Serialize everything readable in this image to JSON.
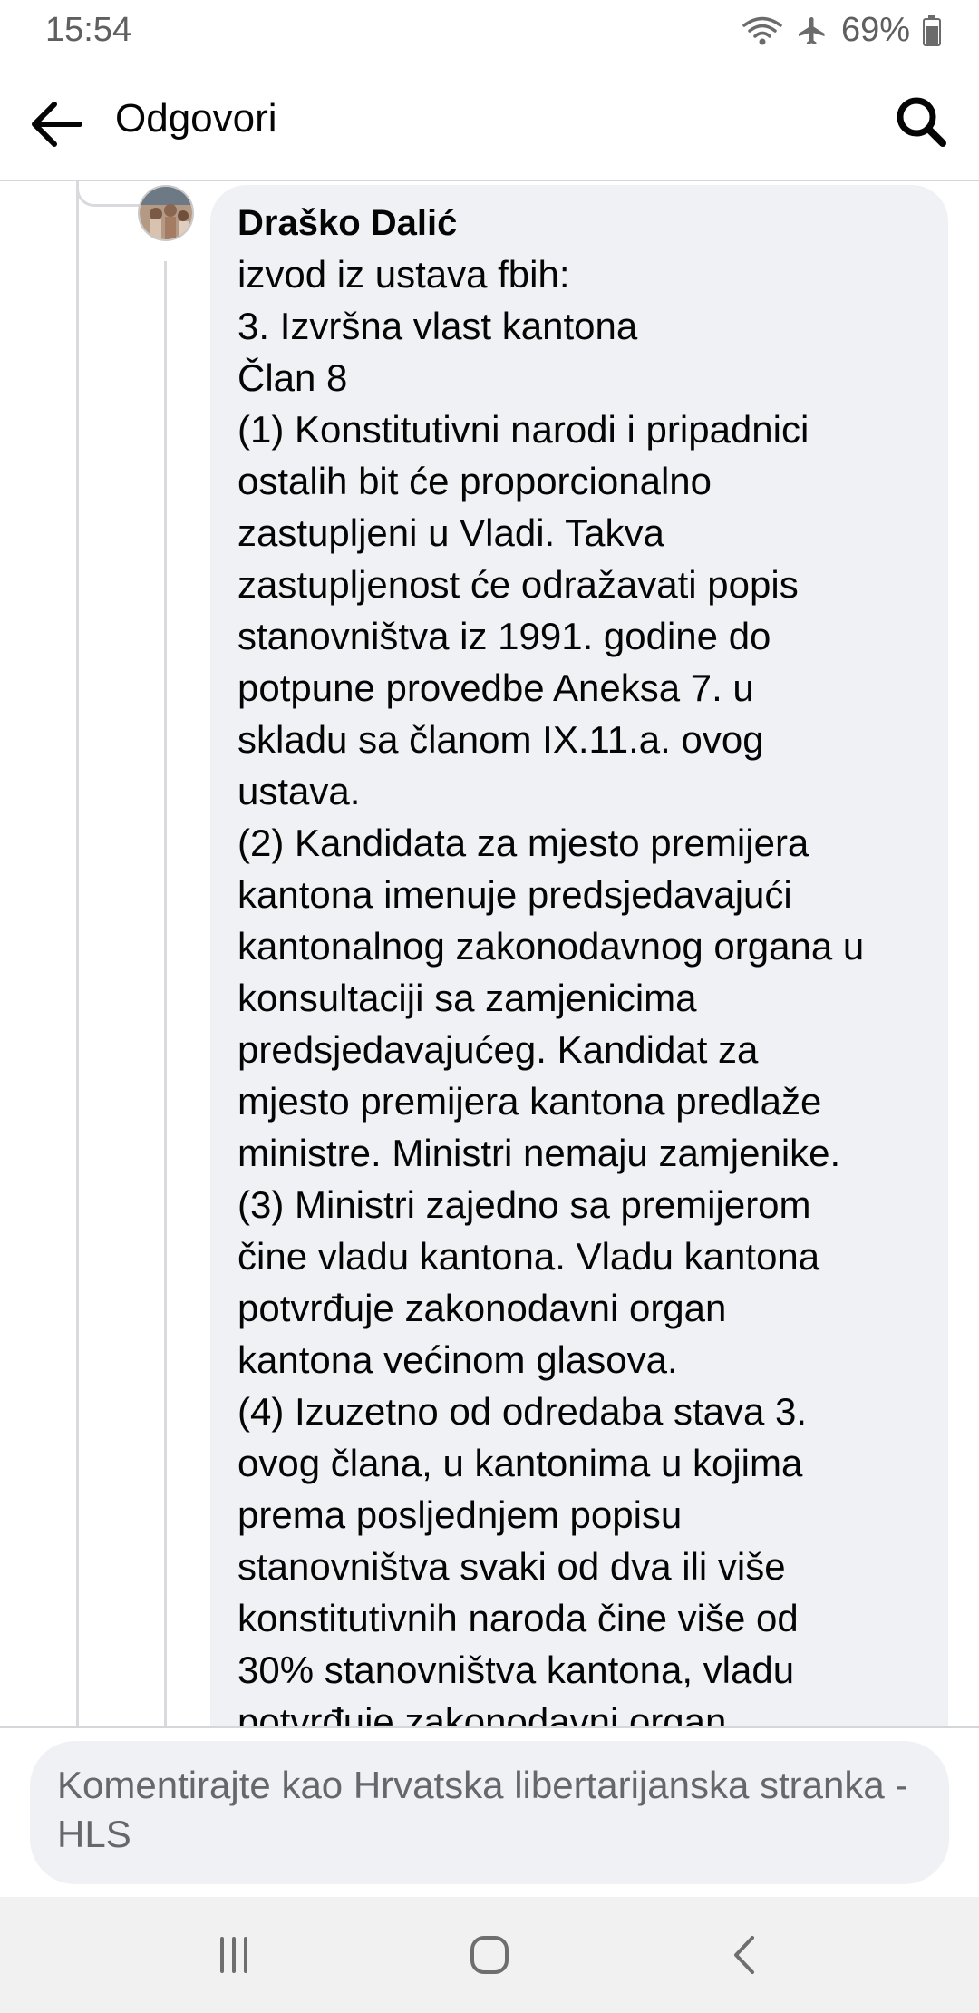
{
  "status": {
    "time": "15:54",
    "battery": "69%",
    "icons": [
      "wifi-icon",
      "airplane-icon",
      "battery-icon"
    ]
  },
  "app_bar": {
    "title": "Odgovori",
    "icons": [
      "back-arrow-icon",
      "search-icon"
    ]
  },
  "comment": {
    "author": "Draško Dalić",
    "lines": [
      "izvod iz ustava fbih:",
      "3. Izvršna vlast kantona",
      "Član 8",
      "(1) Konstitutivni narodi i pripadnici",
      "ostalih bit će proporcionalno",
      "zastupljeni u Vladi. Takva",
      "zastupljenost će odražavati popis",
      "stanovništva iz 1991. godine do",
      "potpune provedbe Aneksa 7. u",
      "skladu sa članom IX.11.a. ovog",
      "ustava.",
      "(2) Kandidata za mjesto premijera",
      "kantona imenuje predsjedavajući",
      "kantonalnog zakonodavnog organa u",
      "konsultaciji sa zamjenicima",
      "predsjedavajućeg. Kandidat za",
      "mjesto premijera kantona predlaže",
      "ministre. Ministri nemaju zamjenike.",
      "(3) Ministri zajedno sa premijerom",
      "čine vladu kantona. Vladu kantona",
      "potvrđuje zakonodavni organ",
      "kantona većinom glasova.",
      "(4) Izuzetno od odredaba stava 3.",
      "ovog člana, u kantonima u kojima",
      "prema posljednjem popisu",
      "stanovništva svaki od dva ili više",
      "konstitutivnih naroda čine više od",
      "30% stanovništva kantona, vladu",
      "potvrđuje zakonodavni organ"
    ]
  },
  "composer": {
    "placeholder": "Komentirajte kao Hrvatska libertarijanska stranka - HLS"
  },
  "nav": {
    "icons": [
      "recent-apps-icon",
      "home-icon",
      "back-icon"
    ]
  }
}
